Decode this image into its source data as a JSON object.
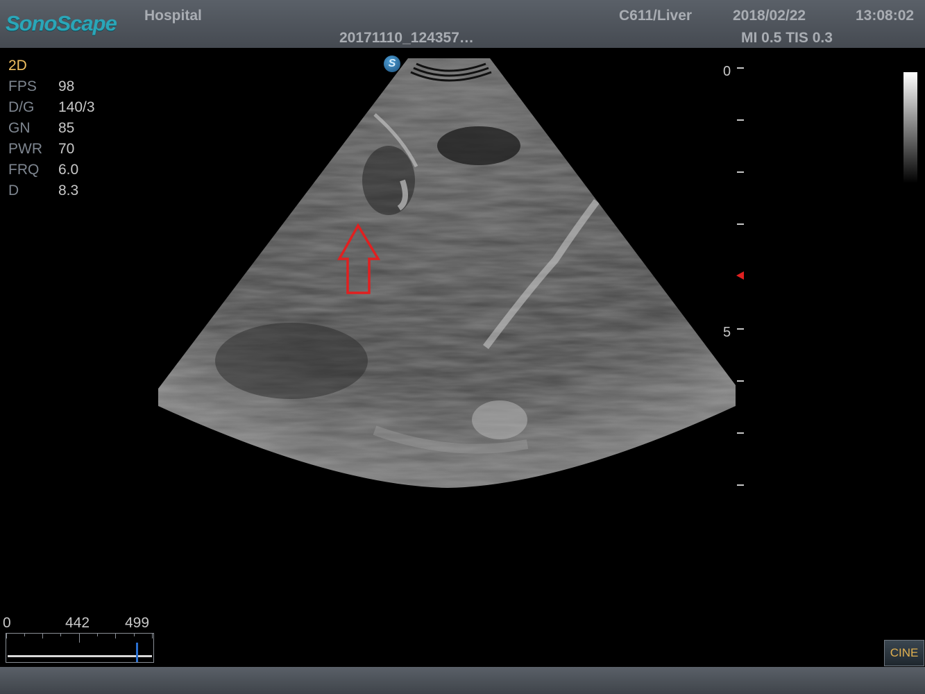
{
  "header": {
    "logo": "SonoScape",
    "institution": "Hospital",
    "patient_id": "20171110_124357…",
    "probe_exam": "C611/Liver",
    "date": "2018/02/22",
    "time": "13:08:02",
    "indices": "MI 0.5 TIS 0.3"
  },
  "params": {
    "mode": "2D",
    "items": [
      {
        "label": "FPS",
        "value": "98"
      },
      {
        "label": "D/G",
        "value": "140/3"
      },
      {
        "label": "GN",
        "value": "85"
      },
      {
        "label": "PWR",
        "value": "70"
      },
      {
        "label": "FRQ",
        "value": "6.0"
      },
      {
        "label": "D",
        "value": "8.3"
      }
    ]
  },
  "image": {
    "badge": "S",
    "annotation_icon": "up-arrow-icon",
    "annotation_color": "#e02020"
  },
  "depth_scale": {
    "labels": [
      "0",
      "5"
    ],
    "focus_color": "#e02020"
  },
  "cine": {
    "start": "0",
    "current": "442",
    "end": "499",
    "button_label": "CINE",
    "cursor_color": "#2a6fd0"
  }
}
